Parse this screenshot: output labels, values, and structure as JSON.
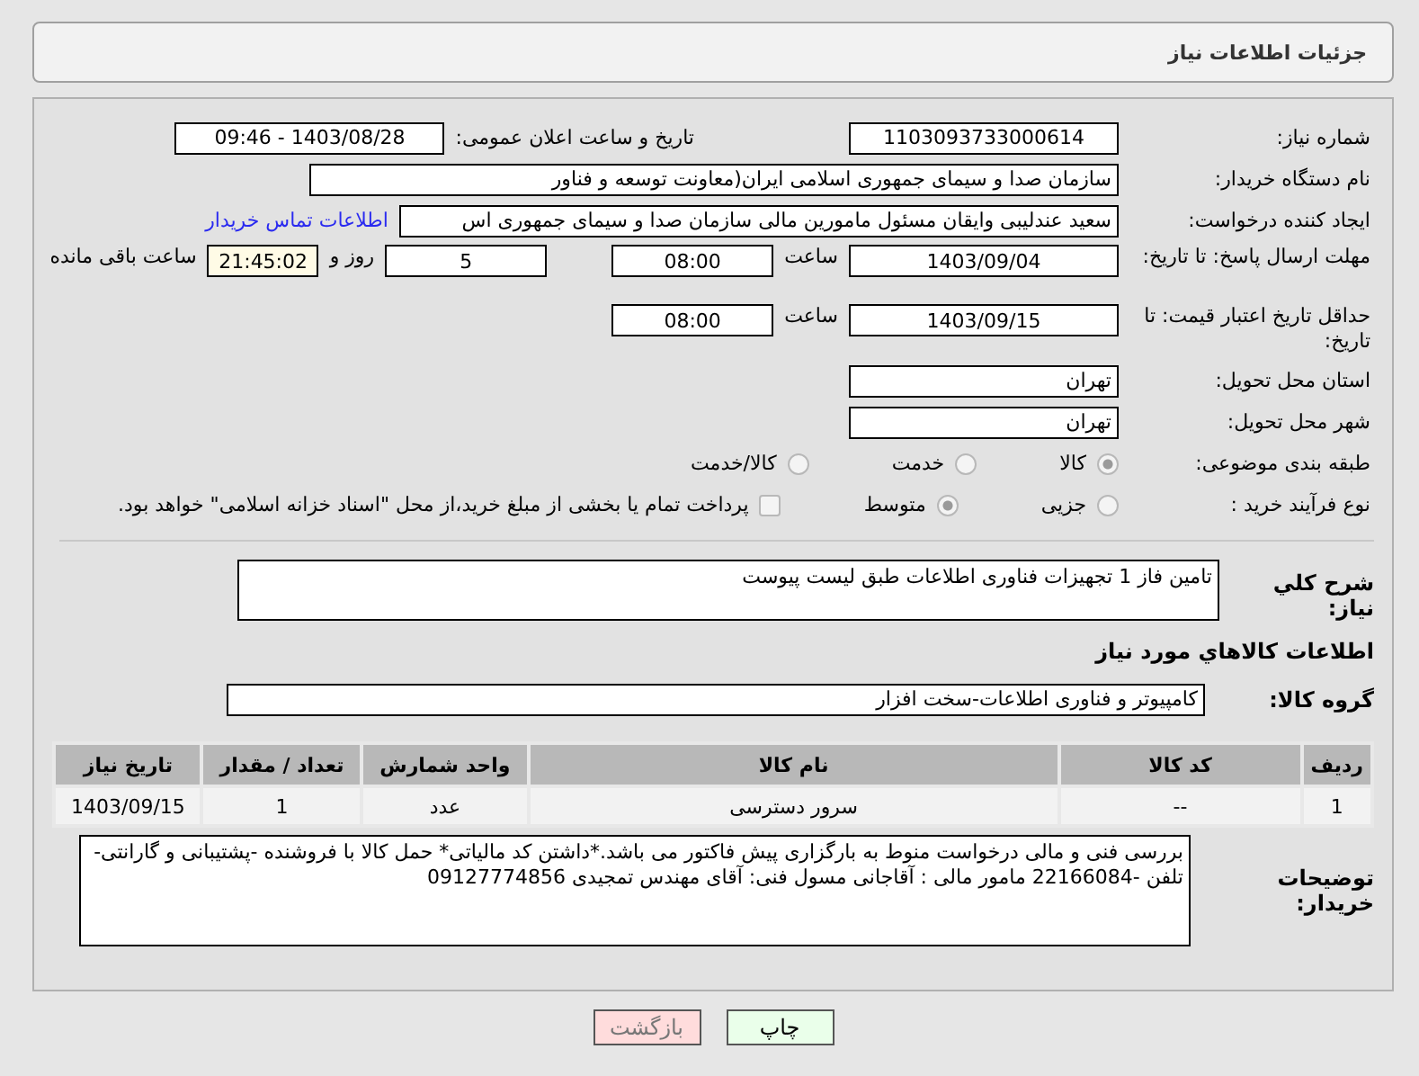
{
  "header": {
    "title": "جزئیات اطلاعات نیاز"
  },
  "need_number": {
    "label": "شماره نیاز:",
    "value": "1103093733000614"
  },
  "announce": {
    "label": "تاریخ و ساعت اعلان عمومی:",
    "value": "1403/08/28 - 09:46"
  },
  "buyer_org": {
    "label": "نام دستگاه خریدار:",
    "value": "سازمان صدا و سیمای جمهوری اسلامی ایران(معاونت توسعه و فناور"
  },
  "creator": {
    "label": "ایجاد کننده درخواست:",
    "value": "سعید عندلیبی وایقان مسئول مامورین مالی  سازمان صدا و سیمای جمهوری اس",
    "link": "اطلاعات تماس خریدار"
  },
  "deadline": {
    "label": "مهلت ارسال پاسخ: تا تاریخ:",
    "date": "1403/09/04",
    "time_label": "ساعت",
    "time": "08:00",
    "days": "5",
    "days_label": "روز و",
    "remaining": "21:45:02",
    "remaining_label": "ساعت باقی مانده"
  },
  "price_validity": {
    "label": "حداقل تاریخ اعتبار قیمت: تا تاریخ:",
    "date": "1403/09/15",
    "time_label": "ساعت",
    "time": "08:00"
  },
  "province": {
    "label": "استان محل تحویل:",
    "value": "تهران"
  },
  "city": {
    "label": "شهر محل تحویل:",
    "value": "تهران"
  },
  "category": {
    "label": "طبقه بندی موضوعی:",
    "options": [
      {
        "label": "کالا",
        "selected": true
      },
      {
        "label": "خدمت",
        "selected": false
      },
      {
        "label": "کالا/خدمت",
        "selected": false
      }
    ]
  },
  "process": {
    "label": "نوع فرآیند خرید :",
    "options": [
      {
        "label": "جزیی",
        "selected": false
      },
      {
        "label": "متوسط",
        "selected": true
      }
    ],
    "payment_check": {
      "label": "پرداخت تمام یا بخشی از مبلغ خرید،از محل \"اسناد خزانه اسلامی\" خواهد بود.",
      "checked": false
    }
  },
  "summary": {
    "label": "شرح کلي نياز:",
    "value": "تامین فاز 1 تجهیزات فناوری اطلاعات طبق لیست پیوست"
  },
  "goods_heading": "اطلاعات کالاهاي مورد نياز",
  "goods_group": {
    "label": "گروه کالا:",
    "value": "کامپیوتر و فناوری اطلاعات-سخت افزار"
  },
  "table": {
    "columns": [
      "ردیف",
      "کد کالا",
      "نام کالا",
      "واحد شمارش",
      "تعداد / مقدار",
      "تاریخ نیاز"
    ],
    "rows": [
      [
        "1",
        "--",
        "سرور دسترسی",
        "عدد",
        "1",
        "1403/09/15"
      ]
    ]
  },
  "buyer_notes": {
    "label": "توضیحات خریدار:",
    "value": "بررسی فنی و مالی درخواست منوط به بارگزاری پیش فاکتور می باشد.*داشتن کد مالیاتی*  حمل کالا با فروشنده -پشتیبانی و گارانتی- تلفن -22166084 مامور مالی : آقاجانی مسول فنی: آقای مهندس تمجیدی 09127774856"
  },
  "buttons": [
    {
      "label": "چاپ",
      "kind": "print"
    },
    {
      "label": "بازگشت",
      "kind": "back"
    }
  ]
}
